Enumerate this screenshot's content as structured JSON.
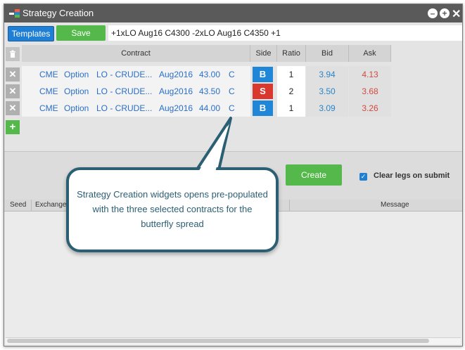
{
  "window": {
    "title": "Strategy Creation"
  },
  "toolbar": {
    "templates_label": "Templates",
    "save_label": "Save",
    "strategy_text": "+1xLO Aug16 C4300 -2xLO Aug16 C4350 +1"
  },
  "grid": {
    "headers": {
      "contract": "Contract",
      "side": "Side",
      "ratio": "Ratio",
      "bid": "Bid",
      "ask": "Ask"
    },
    "rows": [
      {
        "exchange": "CME",
        "type": "Option",
        "product": "LO - CRUDE...",
        "expiry": "Aug2016",
        "strike": "43.00",
        "cp": "C",
        "side": "B",
        "ratio": "1",
        "bid": "3.94",
        "ask": "4.13"
      },
      {
        "exchange": "CME",
        "type": "Option",
        "product": "LO - CRUDE...",
        "expiry": "Aug2016",
        "strike": "43.50",
        "cp": "C",
        "side": "S",
        "ratio": "2",
        "bid": "3.50",
        "ask": "3.68"
      },
      {
        "exchange": "CME",
        "type": "Option",
        "product": "LO - CRUDE...",
        "expiry": "Aug2016",
        "strike": "44.00",
        "cp": "C",
        "side": "B",
        "ratio": "1",
        "bid": "3.09",
        "ask": "3.26"
      }
    ]
  },
  "actions": {
    "create_label": "Create",
    "clear_legs_label": "Clear legs on submit",
    "clear_legs_checked": true
  },
  "log": {
    "headers": {
      "seed": "Seed",
      "exchange": "Exchange",
      "message": "Message"
    }
  },
  "callout": {
    "text": "Strategy Creation widgets opens pre-populated with the three selected contracts for the butterfly spread"
  },
  "colors": {
    "buy": "#1f86d8",
    "sell": "#d9382e",
    "bid": "#2a85c9",
    "ask": "#d24a3f",
    "green": "#54b94a",
    "titlebar": "#5a5a5a",
    "callout_border": "#2b5f74"
  }
}
